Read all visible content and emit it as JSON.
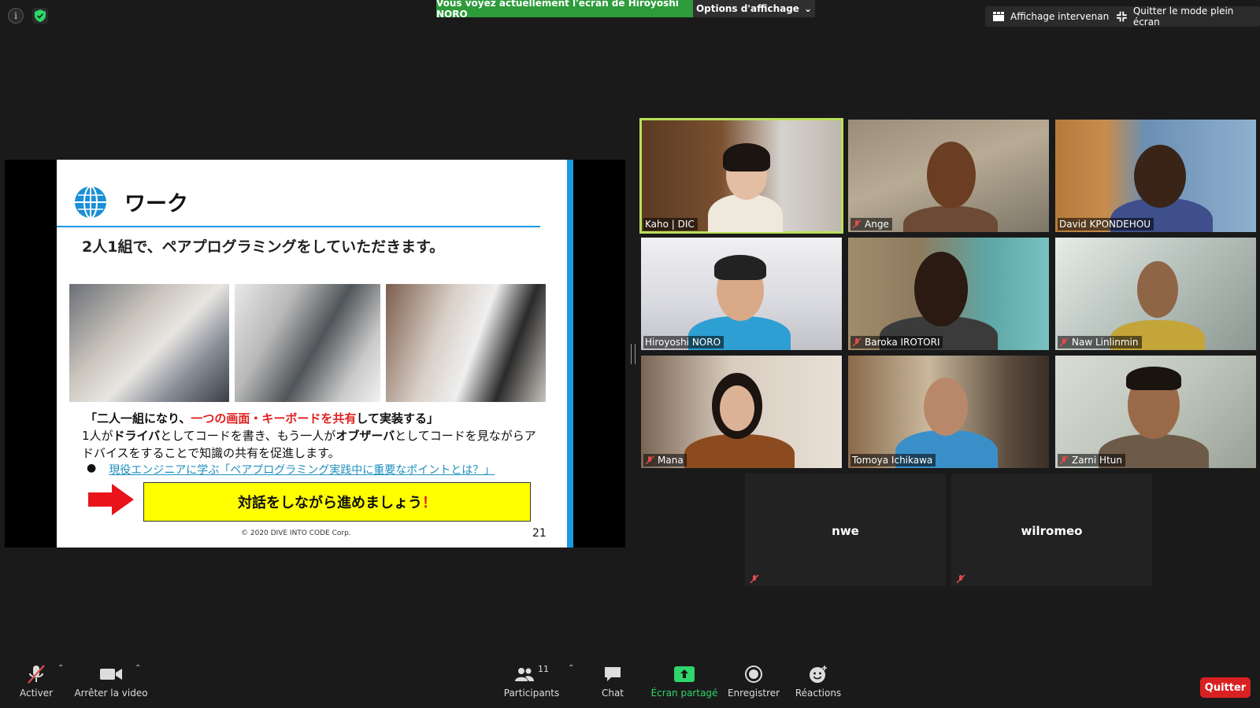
{
  "topbar": {
    "share_banner": "Vous voyez actuellement l'écran de Hiroyoshi NORO",
    "view_options": "Options d'affichage",
    "speaker_view": "Affichage intervenant",
    "exit_fullscreen": "Quitter le mode plein écran"
  },
  "slide": {
    "title": "ワーク",
    "lead": "2人1組で、ペアプログラミングをしていただきます。",
    "quote_a": "「二人一組になり、",
    "quote_b": "一つの画面・キーボードを共有",
    "quote_c": "して実装する」",
    "body_1": "1人が",
    "body_2": "ドライバ",
    "body_3": "としてコードを書き、もう一人が",
    "body_4": "オブザーバ",
    "body_5": "としてコードを見ながらアドバイスをすることで知識の共有を促進します。",
    "bullet_link": "現役エンジニアに学ぶ「ペアプログラミング実践中に重要なポイントとは？」",
    "cta": "対話をしながら進めましょう",
    "cta_mark": "！",
    "copyright": "© 2020 DIVE INTO CODE Corp.",
    "page_number": "21"
  },
  "participants": [
    {
      "name": "Kaho | DIC",
      "muted": false,
      "active": true
    },
    {
      "name": "Ange",
      "muted": true,
      "active": false
    },
    {
      "name": "David KPONDEHOU",
      "muted": false,
      "active": false
    },
    {
      "name": "Hiroyoshi NORO",
      "muted": false,
      "active": false
    },
    {
      "name": "Baroka IROTORI",
      "muted": true,
      "active": false
    },
    {
      "name": "Naw Linlinmin",
      "muted": true,
      "active": false
    },
    {
      "name": "Mana",
      "muted": true,
      "active": false
    },
    {
      "name": "Tomoya Ichikawa",
      "muted": false,
      "active": false
    },
    {
      "name": "Zarni Htun",
      "muted": true,
      "active": false
    }
  ],
  "no_video": [
    {
      "name": "nwe",
      "muted": true
    },
    {
      "name": "wilromeo",
      "muted": true
    }
  ],
  "toolbar": {
    "unmute": "Activer",
    "stop_video": "Arrêter la video",
    "participants": "Participants",
    "participants_count": "11",
    "chat": "Chat",
    "share_screen": "Écran partagé",
    "record": "Enregistrer",
    "reactions": "Réactions",
    "quit": "Quitter"
  },
  "colors": {
    "share_green": "#2d9b3a",
    "active_speaker": "#b8e05a",
    "quit_red": "#d92121",
    "slide_blue": "#1a9ae0"
  }
}
